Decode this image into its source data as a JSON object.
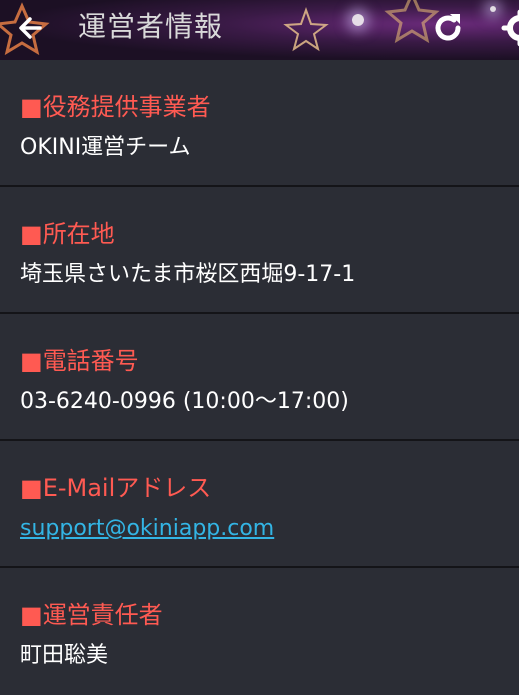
{
  "app_bar": {
    "title": "運営者情報",
    "back_icon": "arrow-left-icon",
    "refresh_icon": "refresh-icon",
    "settings_icon": "gear-icon"
  },
  "sections": [
    {
      "heading_marker": "■",
      "heading": "役務提供事業者",
      "value": "OKINI運営チーム"
    },
    {
      "heading_marker": "■",
      "heading": "所在地",
      "value": "埼玉県さいたま市桜区西堀9-17-1"
    },
    {
      "heading_marker": "■",
      "heading": "電話番号",
      "value": "03-6240-0996 (10:00〜17:00)"
    },
    {
      "heading_marker": "■",
      "heading": "E-Mailアドレス",
      "value": "support@okiniapp.com"
    },
    {
      "heading_marker": "■",
      "heading": "運営責任者",
      "value": "町田聡美"
    }
  ],
  "colors": {
    "background": "#2b2d35",
    "heading": "#ff5a52",
    "link": "#33b5e5",
    "divider": "#141418"
  }
}
